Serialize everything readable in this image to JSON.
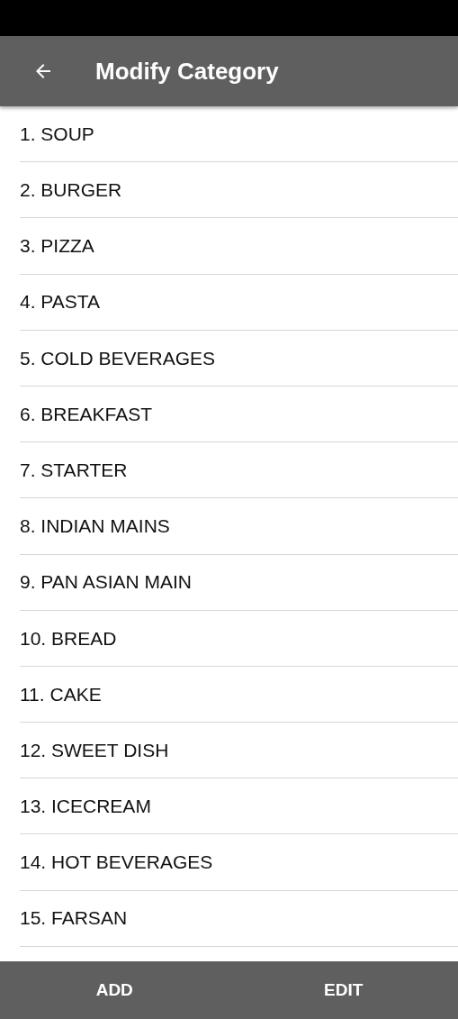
{
  "app_bar": {
    "title": "Modify Category"
  },
  "categories": [
    {
      "label": "1. SOUP"
    },
    {
      "label": "2. BURGER"
    },
    {
      "label": "3. PIZZA"
    },
    {
      "label": "4. PASTA"
    },
    {
      "label": "5. COLD BEVERAGES"
    },
    {
      "label": "6. BREAKFAST"
    },
    {
      "label": "7. STARTER"
    },
    {
      "label": "8. INDIAN MAINS"
    },
    {
      "label": "9. PAN ASIAN MAIN"
    },
    {
      "label": "10. BREAD"
    },
    {
      "label": "11. CAKE"
    },
    {
      "label": "12. SWEET DISH"
    },
    {
      "label": "13. ICECREAM"
    },
    {
      "label": "14. HOT BEVERAGES"
    },
    {
      "label": "15. FARSAN"
    }
  ],
  "bottom_buttons": [
    {
      "label": "ADD"
    },
    {
      "label": "EDIT"
    }
  ]
}
